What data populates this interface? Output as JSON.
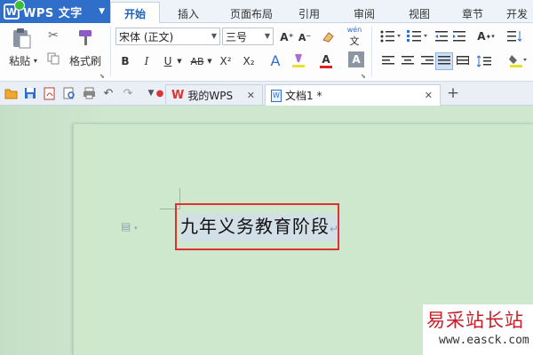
{
  "app": {
    "title": "WPS 文字",
    "logo_letter": "W"
  },
  "menu": {
    "tabs": [
      "开始",
      "插入",
      "页面布局",
      "引用",
      "审阅",
      "视图",
      "章节",
      "开发"
    ],
    "active": "开始"
  },
  "ribbon": {
    "paste_label": "粘贴",
    "format_painter_label": "格式刷",
    "font_name": "宋体 (正文)",
    "font_size": "三号",
    "grow_font": "A⁺",
    "shrink_font": "A⁻",
    "bold": "B",
    "italic": "I",
    "underline": "U",
    "strikethrough": "AB",
    "superscript": "X²",
    "subscript": "X₂",
    "font_color_letter": "A",
    "char_shade": "A",
    "pinyin": "wén",
    "accent_color": "#2f6fca",
    "highlight_color": "#e8e030",
    "font_color": "#e02020"
  },
  "quickbar": {
    "icons": [
      "open-folder-icon",
      "save-icon",
      "pdf-icon",
      "print-preview-icon",
      "print-icon",
      "undo-icon",
      "redo-icon",
      "customize-icon"
    ]
  },
  "doc_tabs": [
    {
      "label": "我的WPS",
      "active": false
    },
    {
      "label": "文档1 *",
      "active": true
    }
  ],
  "new_tab_label": "+",
  "document": {
    "text": "九年义务教育阶段",
    "paragraph_mark": "↵"
  },
  "watermark": {
    "title": "易采站长站",
    "url": "www.easck.com"
  }
}
